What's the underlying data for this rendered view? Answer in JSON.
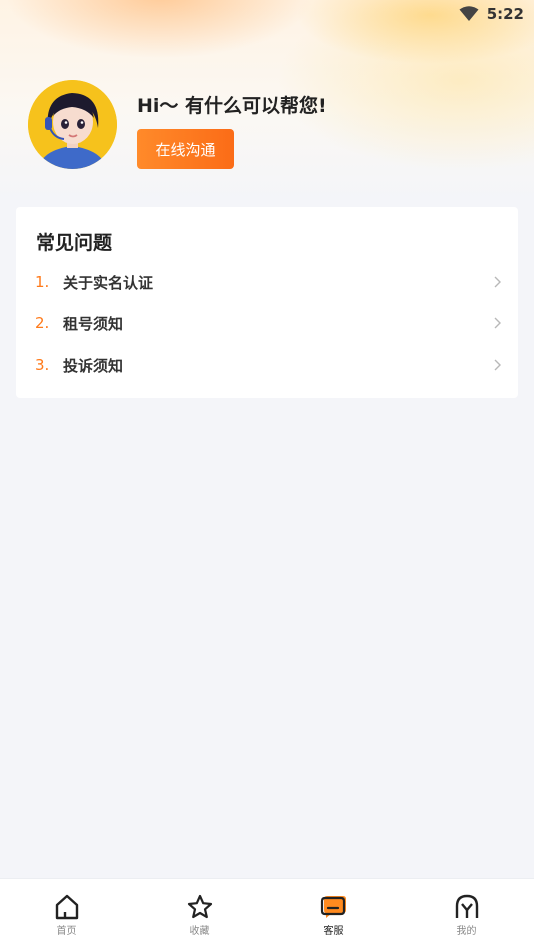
{
  "status_bar": {
    "time": "5:22",
    "wifi_icon": "wifi-icon"
  },
  "header": {
    "greeting": "Hi〜 有什么可以帮您!",
    "chat_button_label": "在线沟通",
    "avatar_icon": "customer-service-avatar"
  },
  "faq": {
    "title": "常见问题",
    "items": [
      {
        "num": "1.",
        "text": "关于实名认证"
      },
      {
        "num": "2.",
        "text": "租号须知"
      },
      {
        "num": "3.",
        "text": "投诉须知"
      }
    ]
  },
  "tabbar": {
    "tabs": [
      {
        "label": "首页",
        "icon": "home-icon",
        "active": false
      },
      {
        "label": "收藏",
        "icon": "star-icon",
        "active": false
      },
      {
        "label": "客服",
        "icon": "chat-icon",
        "active": true
      },
      {
        "label": "我的",
        "icon": "profile-icon",
        "active": false
      }
    ]
  },
  "colors": {
    "accent": "#ff7a1a",
    "background": "#f4f5f9"
  }
}
